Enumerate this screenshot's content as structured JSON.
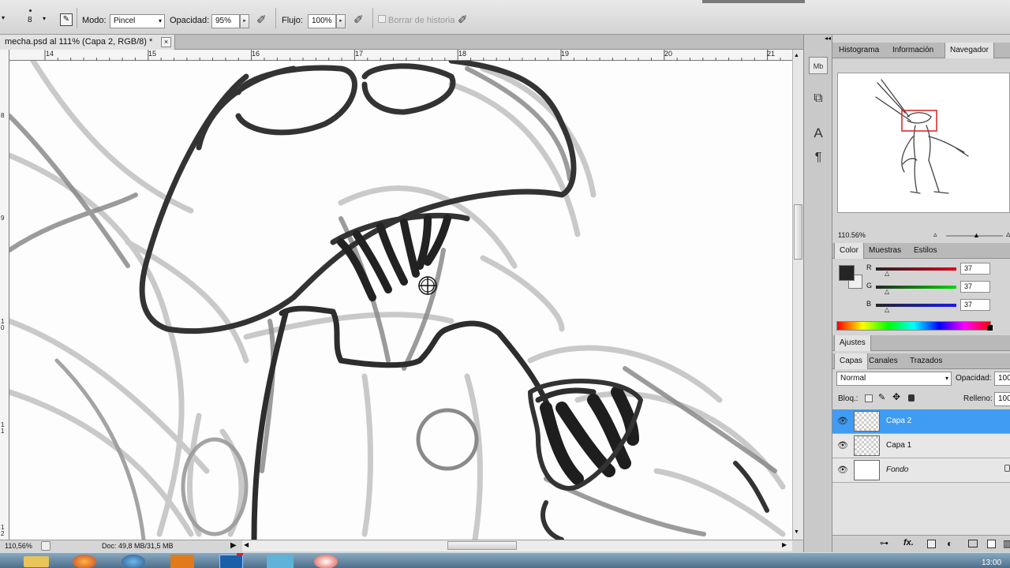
{
  "options_bar": {
    "brush_size": "8",
    "mode_label": "Modo:",
    "mode_value": "Pincel",
    "opacity_label": "Opacidad:",
    "opacity_value": "95%",
    "flow_label": "Flujo:",
    "flow_value": "100%",
    "erase_history_label": "Borrar de historia"
  },
  "document": {
    "tab_title": "mecha.psd al 111% (Capa 2, RGB/8) *",
    "close_glyph": "×",
    "h_ruler_ticks": [
      "14",
      "15",
      "16",
      "17",
      "18",
      "19",
      "20",
      "21"
    ],
    "v_ruler_ticks": [
      "8",
      "9",
      "1 0",
      "1 1",
      "1 2"
    ]
  },
  "status_bar": {
    "zoom": "110,56%",
    "doc_info": "Doc: 49,8 MB/31,5 MB"
  },
  "panels": {
    "top_tabs": [
      "Histograma",
      "Información",
      "Navegador"
    ],
    "navigator_zoom": "110.56%",
    "color_tabs": [
      "Color",
      "Muestras",
      "Estilos"
    ],
    "rgb": {
      "r_label": "R",
      "r_value": "37",
      "g_label": "G",
      "g_value": "37",
      "b_label": "B",
      "b_value": "37"
    },
    "foreground_color": "#252525",
    "adjustments_tab": "Ajustes",
    "layer_tabs": [
      "Capas",
      "Canales",
      "Trazados"
    ],
    "blend_mode": "Normal",
    "opacity_label": "Opacidad:",
    "opacity_value": "100",
    "lock_label": "Bloq.:",
    "fill_label": "Relleno:",
    "fill_value": "100",
    "layers": [
      {
        "name": "Capa 2",
        "selected": true
      },
      {
        "name": "Capa 1",
        "selected": false
      },
      {
        "name": "Fondo",
        "selected": false
      }
    ]
  },
  "taskbar": {
    "clock": "13:00"
  },
  "icons": {
    "brush_preset": "brush-preset-icon",
    "brush_panel": "brush-panel-icon",
    "airbrush": "airbrush-icon",
    "pressure": "pressure-icon",
    "mini_bridge": "mini-bridge-icon",
    "history": "history-icon",
    "character": "character-icon",
    "paragraph": "paragraph-icon",
    "visibility": "eye-icon"
  },
  "accent_color": "#3f9cf2"
}
